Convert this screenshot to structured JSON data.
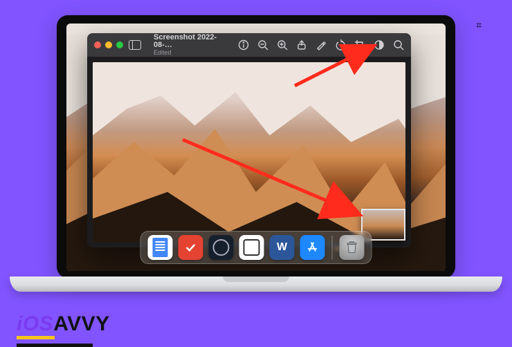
{
  "decor": {
    "bluetooth_glyph": "⌗"
  },
  "preview": {
    "title": "Screenshot 2022-08-…",
    "subtitle": "Edited",
    "toolbar": {
      "sidebar": "sidebar-toggle",
      "info": "info",
      "zoom_out": "zoom-out",
      "zoom_in": "zoom-in",
      "share": "share",
      "markup": "markup",
      "rotate": "rotate-left",
      "crop": "crop",
      "highlight": "highlight",
      "search": "search"
    }
  },
  "dock": {
    "apps": [
      {
        "name": "Google Docs",
        "key": "docs"
      },
      {
        "name": "Todoist",
        "key": "todoist"
      },
      {
        "name": "Steam",
        "key": "steam"
      },
      {
        "name": "Files",
        "key": "files"
      },
      {
        "name": "Microsoft Word",
        "key": "word",
        "letter": "W"
      },
      {
        "name": "App Store",
        "key": "appstore"
      }
    ],
    "trash": "Trash"
  },
  "brand": {
    "part1": "iOS",
    "part2": "AVVY"
  },
  "annotations": {
    "arrow1_target": "crop-tool",
    "arrow2_target": "screenshot-thumbnail"
  }
}
